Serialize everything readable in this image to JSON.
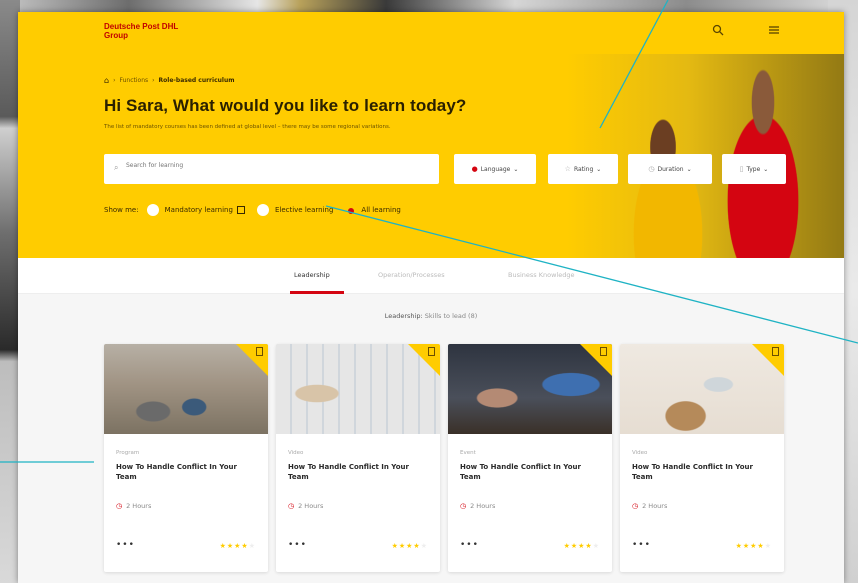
{
  "header": {
    "logo_line1": "Deutsche Post DHL",
    "logo_line2": "Group"
  },
  "breadcrumb": {
    "items": [
      "Functions",
      "Role-based curriculum"
    ]
  },
  "hero": {
    "title": "Hi Sara, What would you like to learn today?",
    "subtitle": "The list of mandatory courses has been defined at global level – there may be some regional variations."
  },
  "search": {
    "placeholder": "Search for learning"
  },
  "filters": [
    {
      "label": "Language"
    },
    {
      "label": "Rating"
    },
    {
      "label": "Duration"
    },
    {
      "label": "Type"
    }
  ],
  "show_me": {
    "label": "Show me:",
    "options": [
      {
        "label": "Mandatory learning",
        "selected": false
      },
      {
        "label": "Elective learning",
        "selected": false
      },
      {
        "label": "All learning",
        "selected": true
      }
    ]
  },
  "tabs": [
    {
      "label": "Leadership",
      "active": true
    },
    {
      "label": "Operation/Processes",
      "active": false
    },
    {
      "label": "Business Knowledge",
      "active": false
    }
  ],
  "section": {
    "title_bold": "Leadership:",
    "title_rest": "Skills to lead (8)"
  },
  "cards": [
    {
      "type": "Program",
      "title": "How To Handle Conflict In Your Team",
      "duration": "2 Hours",
      "rating": 4
    },
    {
      "type": "Video",
      "title": "How To Handle Conflict In Your Team",
      "duration": "2 Hours",
      "rating": 4
    },
    {
      "type": "Event",
      "title": "How To Handle Conflict In Your Team",
      "duration": "2 Hours",
      "rating": 4
    },
    {
      "type": "Video",
      "title": "How To Handle Conflict In Your Team",
      "duration": "2 Hours",
      "rating": 4
    }
  ],
  "colors": {
    "brand_yellow": "#ffcc00",
    "brand_red": "#d40511",
    "annotation_line": "#1fb3c4"
  }
}
